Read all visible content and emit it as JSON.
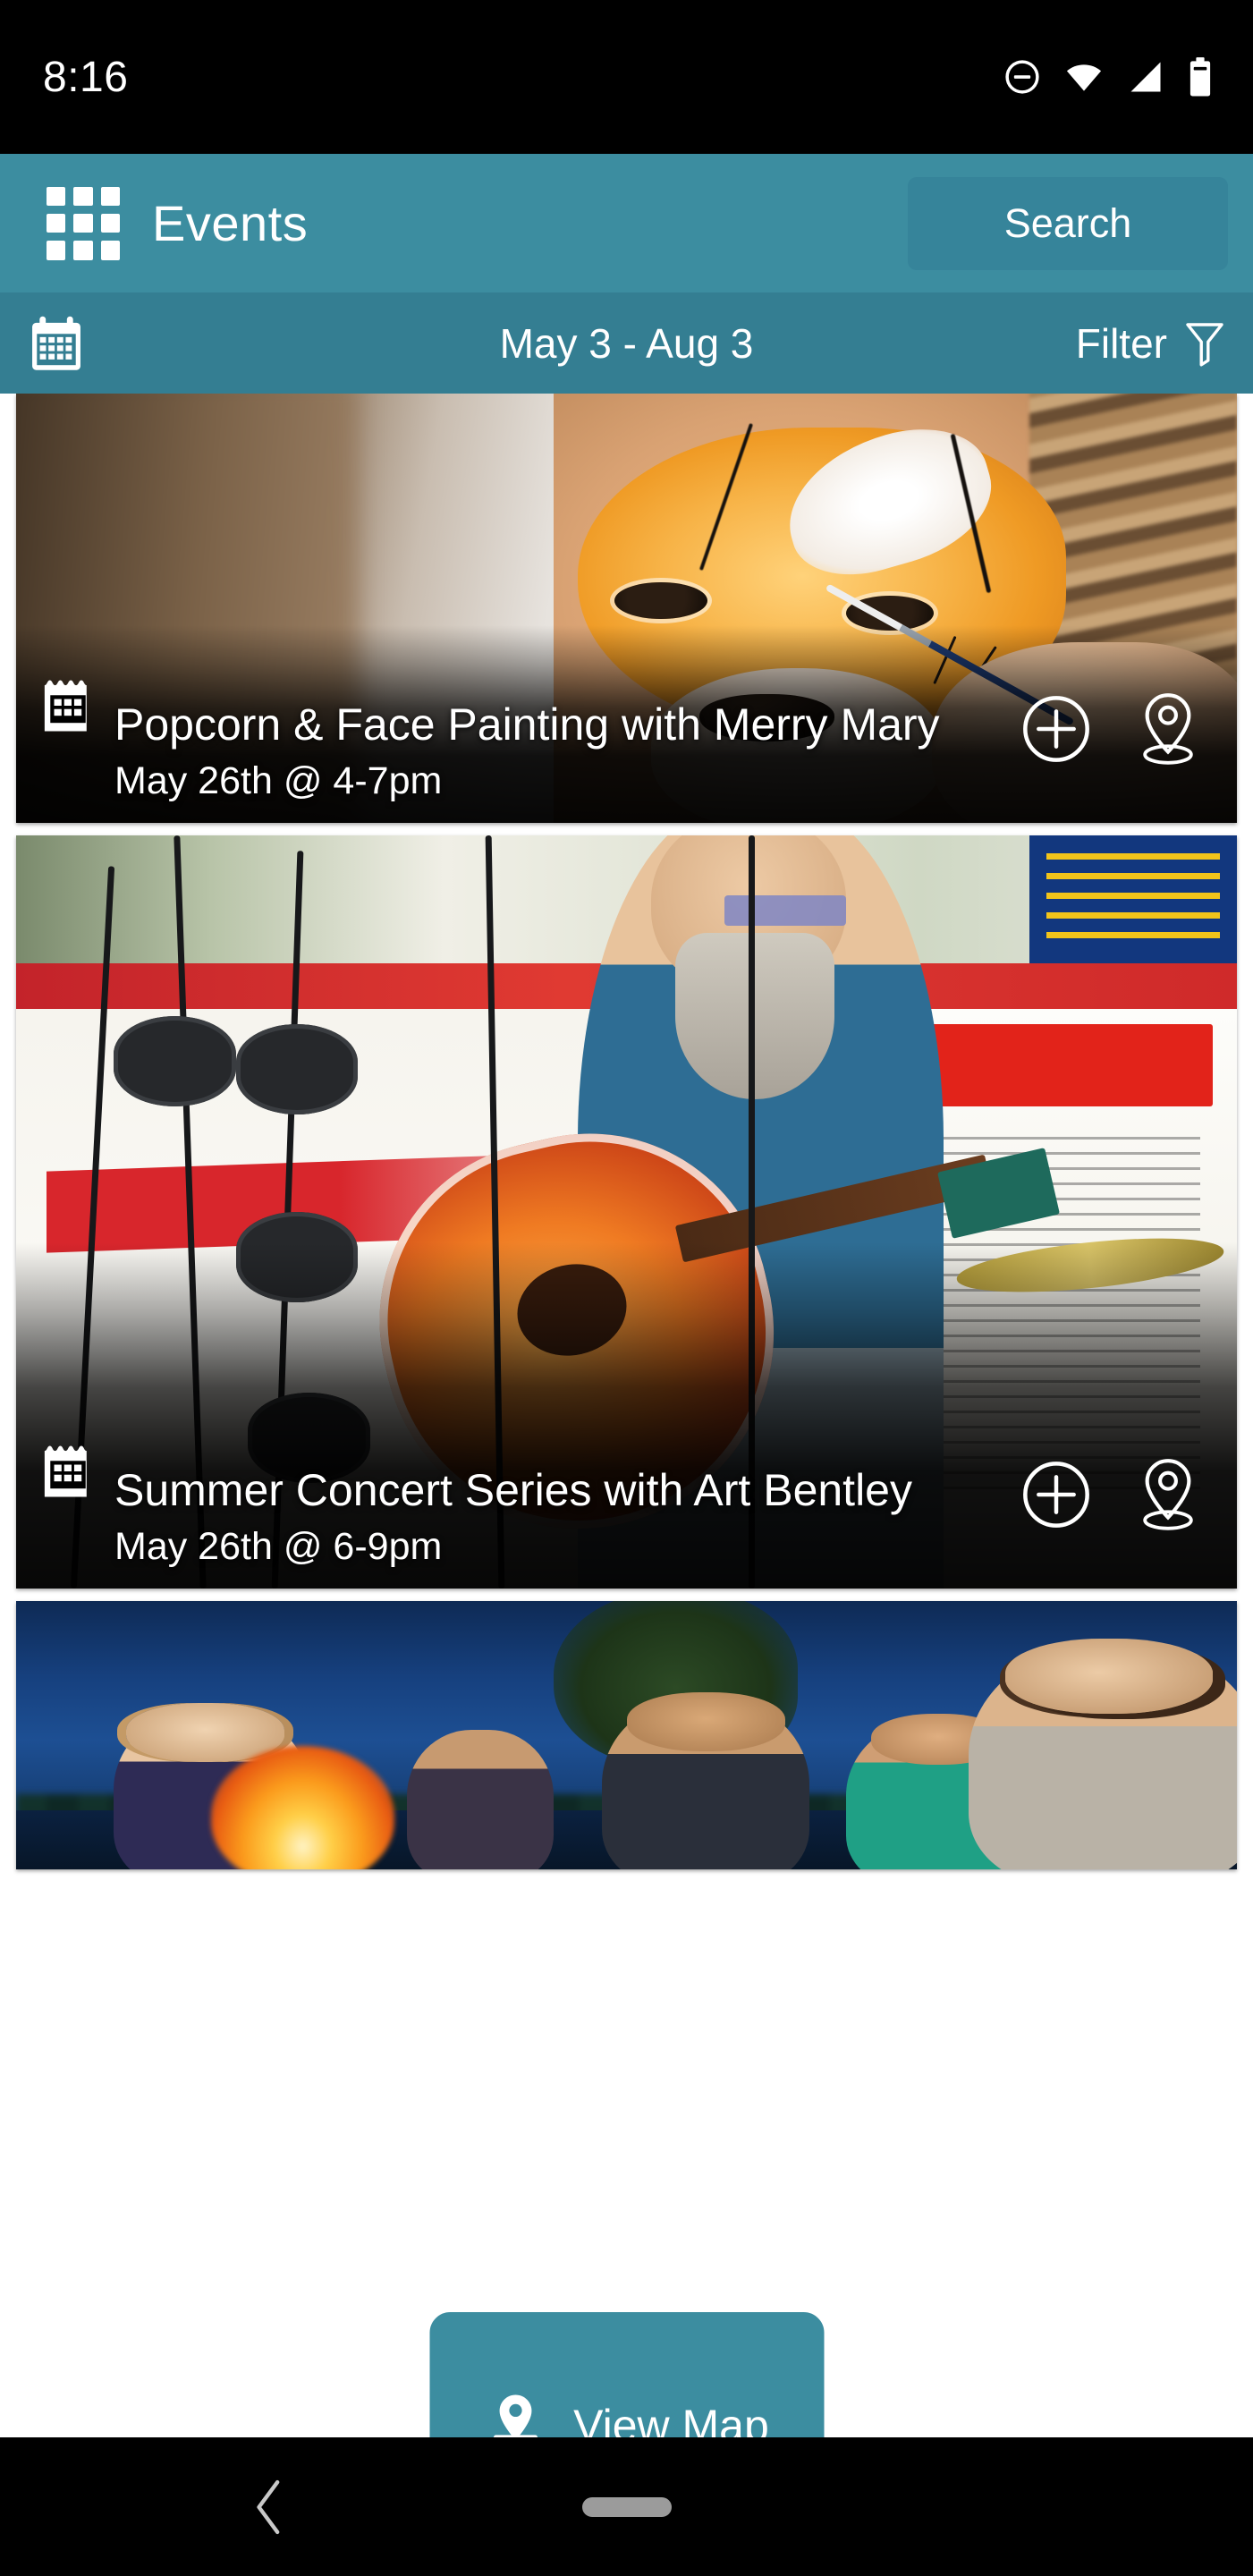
{
  "status_bar": {
    "time": "8:16",
    "icons": [
      "do-not-disturb-icon",
      "wifi-icon",
      "cell-signal-icon",
      "battery-icon"
    ]
  },
  "app_bar": {
    "menu_icon": "grid-menu-icon",
    "title": "Events",
    "search_label": "Search"
  },
  "filter_bar": {
    "calendar_icon": "calendar-icon",
    "date_range": "May 3  -  Aug 3",
    "filter_label": "Filter",
    "filter_icon": "funnel-icon"
  },
  "events": [
    {
      "title": "Popcorn & Face Painting with Merry Mary",
      "date": "May 26th @ 4-7pm",
      "calendar_icon": "calendar-icon",
      "add_icon": "plus-circle-icon",
      "location_icon": "map-pin-icon"
    },
    {
      "title": "Summer Concert Series with Art Bentley",
      "date": "May 26th @ 6-9pm",
      "calendar_icon": "calendar-icon",
      "add_icon": "plus-circle-icon",
      "location_icon": "map-pin-icon"
    }
  ],
  "view_map": {
    "label": "View Map",
    "icon": "map-pin-icon"
  },
  "nav_bar": {
    "back_icon": "back-chevron-icon",
    "home_icon": "home-pill-icon"
  },
  "colors": {
    "app_bar": "#3c8da0",
    "filter_bar": "#347e92",
    "search_button": "#36849a",
    "view_map_button": "#3c8da0",
    "status_bar": "#000000",
    "page_background": "#ffffff"
  }
}
